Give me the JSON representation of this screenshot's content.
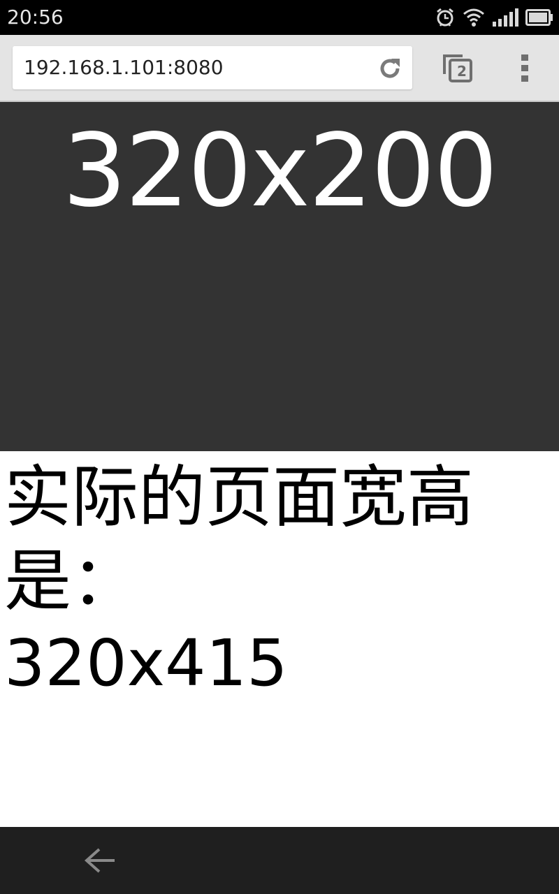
{
  "status_bar": {
    "time": "20:56",
    "icons": [
      "alarm-icon",
      "wifi-icon",
      "signal-icon",
      "battery-icon"
    ]
  },
  "browser": {
    "url": "192.168.1.101:8080",
    "tab_count": "2",
    "icons": {
      "reload": "reload-icon",
      "tabs": "tabs-icon",
      "menu": "overflow-menu-icon"
    }
  },
  "page": {
    "panel_text": "320x200",
    "info_label": "实际的页面宽高是：",
    "info_value": "320x415"
  },
  "nav": {
    "back_icon": "back-arrow-icon"
  },
  "colors": {
    "status_bar": "#000000",
    "toolbar": "#e4e4e4",
    "panel": "#333333",
    "nav_bar": "#1f1f1f"
  }
}
